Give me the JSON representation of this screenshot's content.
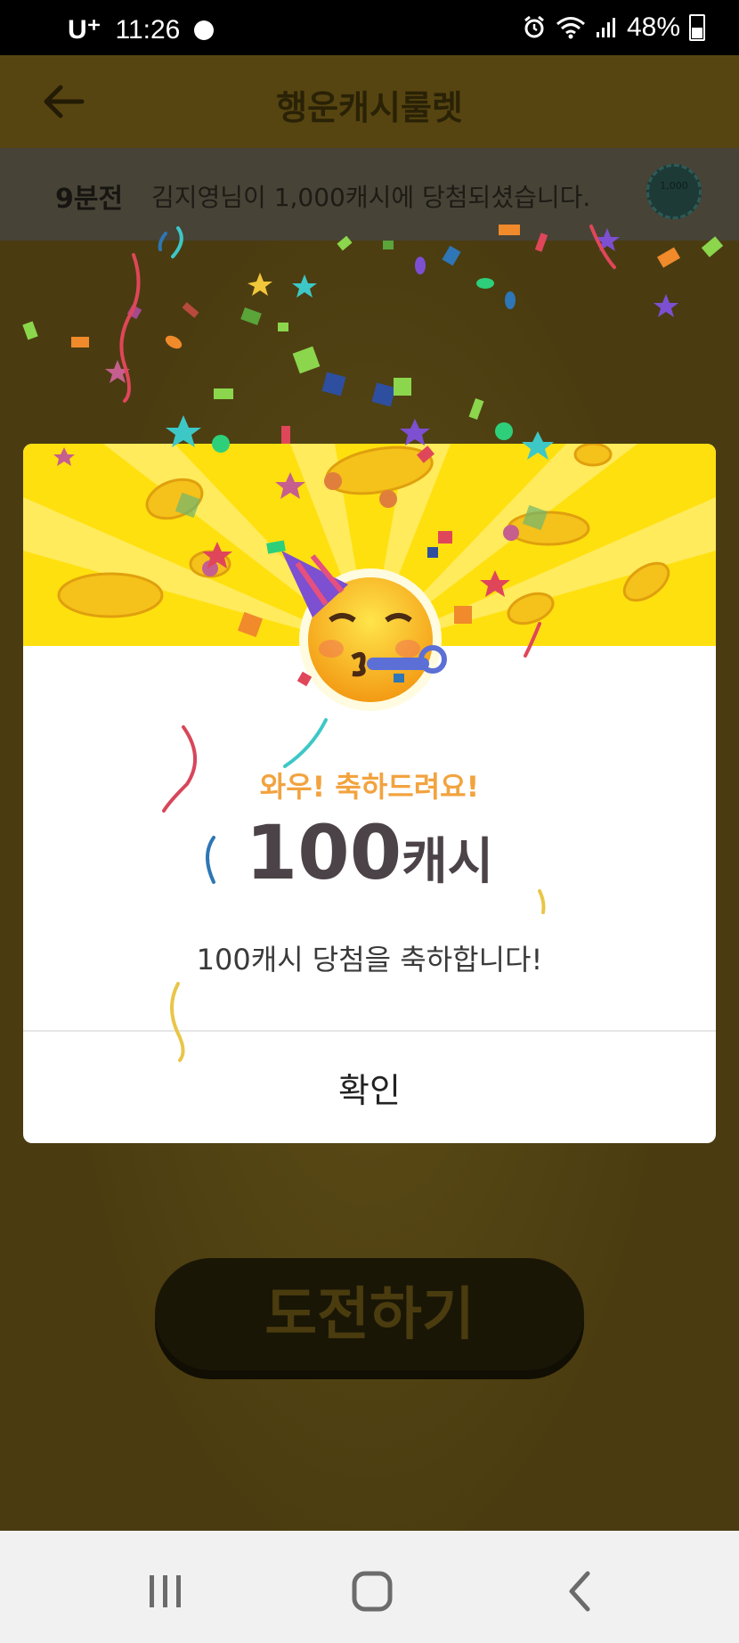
{
  "status_bar": {
    "carrier": "U⁺",
    "time": "11:26",
    "battery": "48%"
  },
  "app_bar": {
    "title": "행운캐시룰렛"
  },
  "ticker": {
    "time_ago": "9분전",
    "message": "김지영님이 1,000캐시에 당첨되셨습니다.",
    "coin_label": "1,000"
  },
  "modal": {
    "headline": "와우! 축하드려요!",
    "amount_number": "100",
    "amount_unit": "캐시",
    "message": "100캐시 당첨을 축하합니다!",
    "confirm_label": "확인"
  },
  "challenge_button": {
    "label": "도전하기"
  },
  "colors": {
    "dim_background": "#4a3c10",
    "modal_header": "#ffe00f",
    "headline": "#f2a33f",
    "amount": "#4c4348"
  },
  "icons": [
    "back-arrow-icon",
    "alarm-icon",
    "wifi-icon",
    "signal-icon",
    "battery-icon",
    "party-face-icon",
    "recents-icon",
    "home-icon",
    "nav-back-icon"
  ]
}
